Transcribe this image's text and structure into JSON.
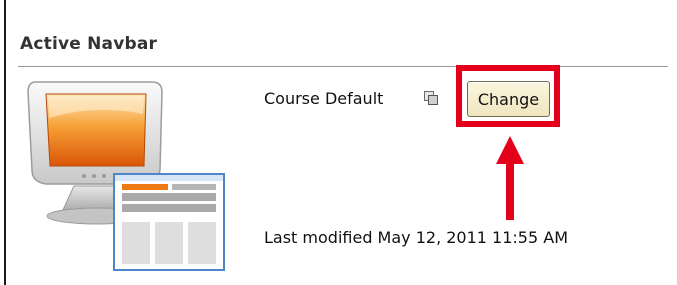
{
  "section": {
    "title": "Active Navbar"
  },
  "navbar_setting": {
    "current_value": "Course Default",
    "change_label": "Change",
    "last_modified": "Last modified May 12, 2011 11:55 AM"
  },
  "icons": {
    "preview": "monitor-navbar-preview-icon",
    "copy": "copy-icon",
    "annotation_arrow": "arrow-up-icon"
  },
  "colors": {
    "highlight": "#e3001b",
    "button_bg": "#f5edcc",
    "screen_orange": "#f07a12"
  }
}
